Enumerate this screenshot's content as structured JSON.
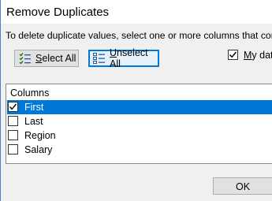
{
  "dialog": {
    "title": "Remove Duplicates",
    "description": "To delete duplicate values, select one or more columns that conta"
  },
  "buttons": {
    "select_all_underlined": "S",
    "select_all_rest": "elect All",
    "unselect_all_underlined": "U",
    "unselect_all_rest": "nselect All",
    "ok_label": "OK"
  },
  "headers_option": {
    "label_underlined": "M",
    "label_rest": "y dat",
    "checked": true
  },
  "columns_list": {
    "header": "Columns",
    "items": [
      {
        "label": "First",
        "checked": true,
        "selected": true
      },
      {
        "label": "Last",
        "checked": false,
        "selected": false
      },
      {
        "label": "Region",
        "checked": false,
        "selected": false
      },
      {
        "label": "Salary",
        "checked": false,
        "selected": false
      }
    ]
  },
  "icons": {
    "select_all": "select-all-checklist-icon",
    "unselect_all": "unselect-all-checklist-icon",
    "check": "checkmark-icon"
  },
  "colors": {
    "selection": "#0078d7",
    "dialog_background": "#f0f0f0",
    "focused_button_border": "#0078d7"
  }
}
